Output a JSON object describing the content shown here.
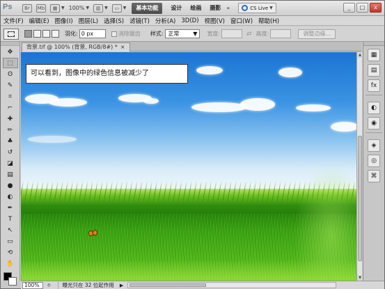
{
  "app": {
    "logo": "Ps",
    "bridge_label": "Br",
    "minibridge_label": "Mb",
    "zoom": "100%",
    "workspaces": {
      "active": "基本功能",
      "design": "设计",
      "paint": "绘画",
      "photo": "摄影",
      "more": "»"
    },
    "cs_live": "CS Live",
    "window_controls": {
      "minimize": "_",
      "maximize": "□",
      "close": "x"
    }
  },
  "menu": [
    "文件(F)",
    "编辑(E)",
    "图像(I)",
    "图层(L)",
    "选择(S)",
    "滤镜(T)",
    "分析(A)",
    "3D(D)",
    "视图(V)",
    "窗口(W)",
    "帮助(H)"
  ],
  "options": {
    "feather_label": "羽化:",
    "feather_value": "0 px",
    "antialias_label": "消除锯齿",
    "style_label": "样式:",
    "style_value": "正常",
    "width_label": "宽度:",
    "height_label": "高度:",
    "swap_icon": "⇄",
    "refine_edge": "调整边缘..."
  },
  "document": {
    "tab_title": "背景.tif @ 100% (背景, RGB/8#) *",
    "close_glyph": "×"
  },
  "caption": "可以看到，图像中的绿色信息被减少了",
  "status": {
    "zoom": "100%",
    "info": "曝光只在 32 位起作用",
    "arrow": "▶"
  },
  "tools": [
    "move-tool",
    "marquee-tool",
    "lasso-tool",
    "quick-select-tool",
    "crop-tool",
    "eyedropper-tool",
    "healing-tool",
    "brush-tool",
    "clone-stamp-tool",
    "history-brush-tool",
    "eraser-tool",
    "gradient-tool",
    "blur-tool",
    "dodge-tool",
    "pen-tool",
    "type-tool",
    "path-select-tool",
    "shape-tool",
    "3d-rotate-tool",
    "3d-orbit-tool",
    "hand-tool",
    "zoom-tool"
  ],
  "tool_glyphs": [
    "✥",
    "⬚",
    "ʘ",
    "✎",
    "⌗",
    "⌐",
    "✚",
    "✏",
    "♣",
    "↺",
    "◪",
    "▤",
    "●",
    "◐",
    "✒",
    "T",
    "↖",
    "▭",
    "⟲",
    "⟳",
    "✋",
    "⌕"
  ],
  "dock_icons": [
    {
      "name": "color-panel-icon",
      "glyph": "▦"
    },
    {
      "name": "swatches-panel-icon",
      "glyph": "▤"
    },
    {
      "name": "styles-panel-icon",
      "glyph": "fx"
    },
    {
      "name": "adjustments-panel-icon",
      "glyph": "◐"
    },
    {
      "name": "masks-panel-icon",
      "glyph": "◉"
    },
    {
      "name": "layers-panel-icon",
      "glyph": "◈"
    },
    {
      "name": "channels-panel-icon",
      "glyph": "◎"
    },
    {
      "name": "paths-panel-icon",
      "glyph": "⌘"
    }
  ],
  "colors": {
    "foreground": "#000000",
    "background": "#ffffff",
    "sky_top": "#1b74d2",
    "grass": "#3ca414"
  }
}
